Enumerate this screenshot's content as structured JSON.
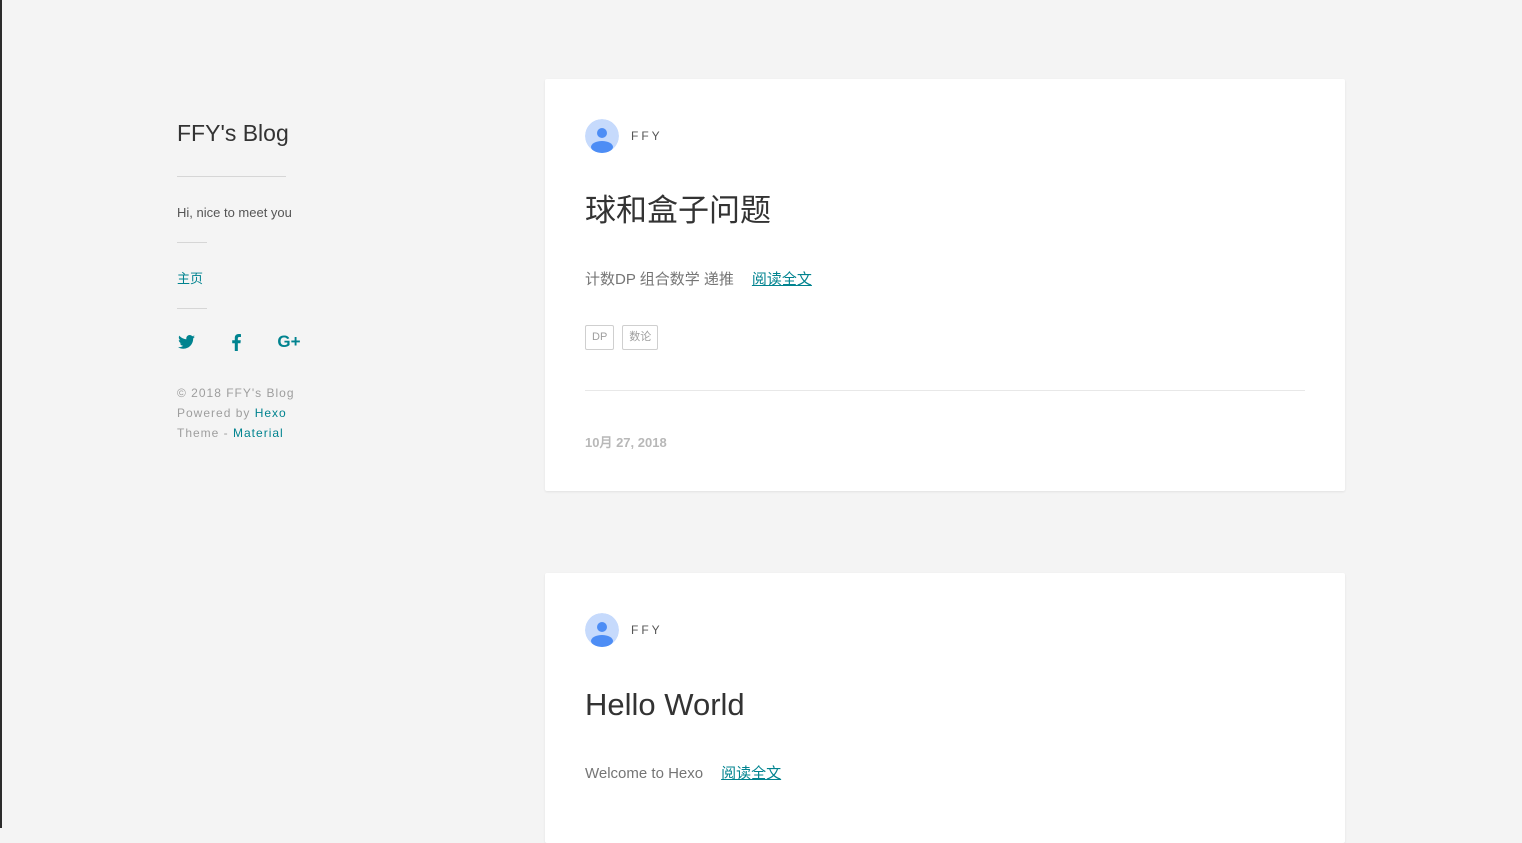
{
  "sidebar": {
    "blog_title": "FFY's Blog",
    "intro": "Hi, nice to meet you",
    "nav": [
      {
        "label": "主页"
      }
    ],
    "social": [
      {
        "icon": "twitter-icon"
      },
      {
        "icon": "facebook-icon"
      },
      {
        "icon": "google-plus-icon",
        "label": "G+"
      }
    ],
    "footer": {
      "copyright": "©  2018  FFY's Blog",
      "powered_prefix": "Powered by ",
      "powered_link": "Hexo",
      "theme_prefix": "Theme - ",
      "theme_link": "Material"
    }
  },
  "posts": [
    {
      "author": "FFY",
      "title": "球和盒子问题",
      "excerpt": "计数DP 组合数学 递推",
      "read_more": "阅读全文",
      "tags": [
        "DP",
        "数论"
      ],
      "date": "10月 27, 2018"
    },
    {
      "author": "FFY",
      "title": "Hello World",
      "excerpt": "Welcome to Hexo",
      "read_more": "阅读全文"
    }
  ],
  "colors": {
    "accent": "#00838f",
    "background": "#f4f4f4",
    "card": "#ffffff",
    "avatar_bg": "#c6dafc",
    "avatar_fg": "#4d8df5"
  }
}
